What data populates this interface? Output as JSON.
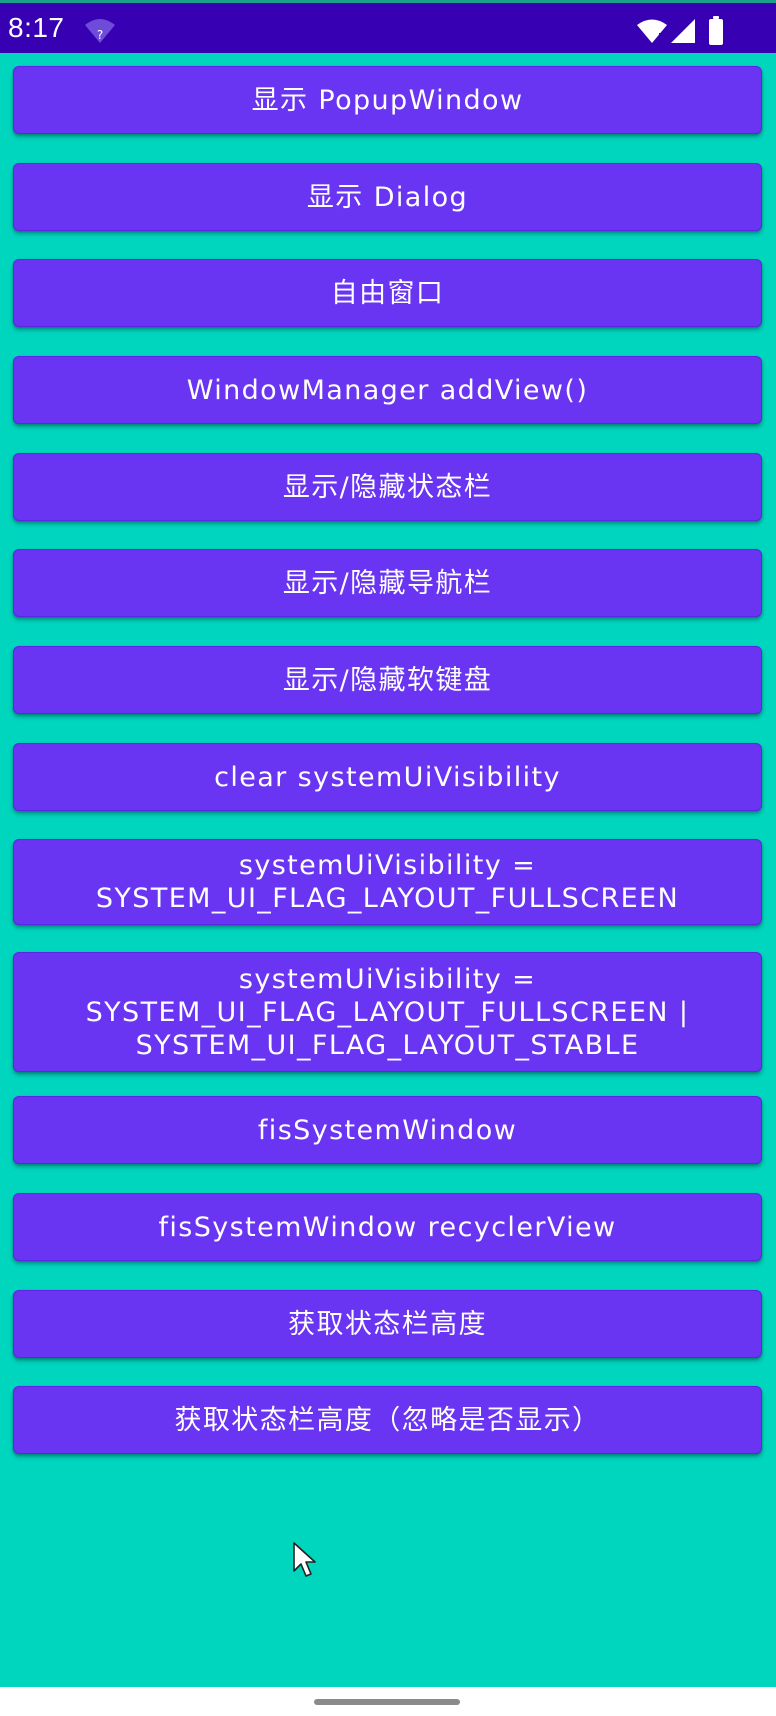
{
  "status_bar": {
    "time": "8:17",
    "icons": [
      "wifi-question-icon",
      "wifi-icon",
      "signal-icon",
      "battery-icon"
    ],
    "background": "#3700B3"
  },
  "colors": {
    "background": "#00D5BE",
    "button": "#6935F2",
    "button_text": "#FFFFFF"
  },
  "buttons": [
    {
      "label": "显示 PopupWindow"
    },
    {
      "label": "显示 Dialog"
    },
    {
      "label": "自由窗口"
    },
    {
      "label": "WindowManager addView()"
    },
    {
      "label": "显示/隐藏状态栏"
    },
    {
      "label": "显示/隐藏导航栏"
    },
    {
      "label": "显示/隐藏软键盘"
    },
    {
      "label": "clear systemUiVisibility"
    },
    {
      "label": "systemUiVisibility =\nSYSTEM_UI_FLAG_LAYOUT_FULLSCREEN"
    },
    {
      "label": "systemUiVisibility =\nSYSTEM_UI_FLAG_LAYOUT_FULLSCREEN |\nSYSTEM_UI_FLAG_LAYOUT_STABLE"
    },
    {
      "label": "fisSystemWindow"
    },
    {
      "label": "fisSystemWindow recyclerView"
    },
    {
      "label": "获取状态栏高度"
    },
    {
      "label": "获取状态栏高度（忽略是否显示）"
    }
  ]
}
